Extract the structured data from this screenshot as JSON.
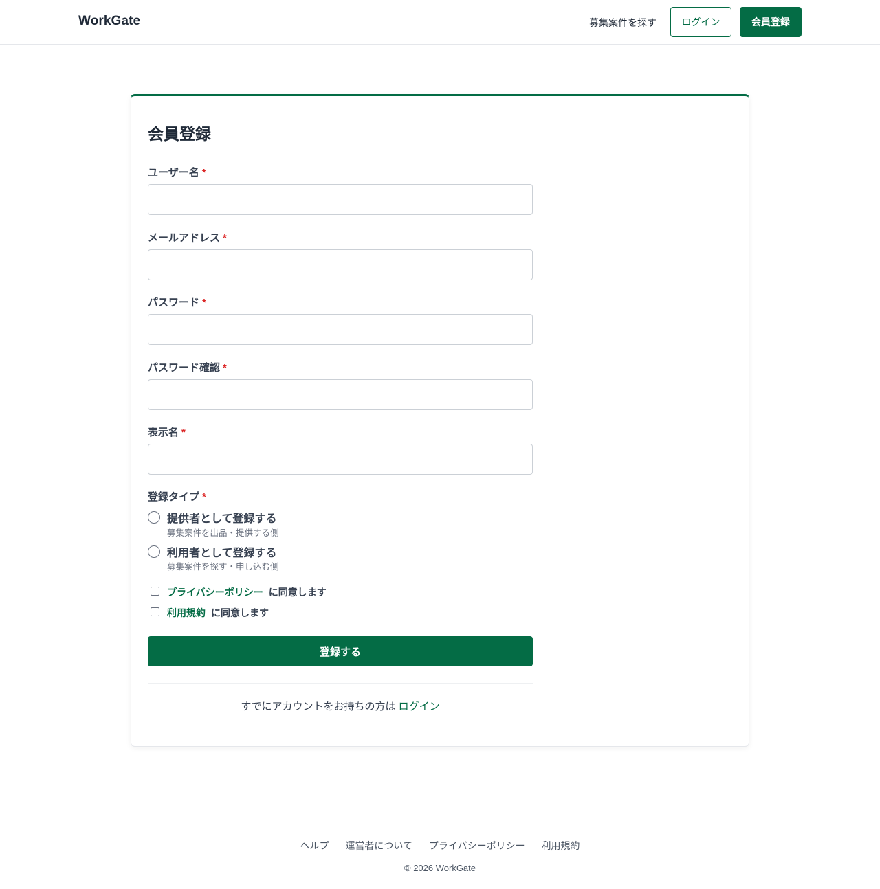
{
  "header": {
    "logo": "WorkGate",
    "nav_search": "募集案件を探す",
    "login_label": "ログイン",
    "register_label": "会員登録"
  },
  "form": {
    "title": "会員登録",
    "required_mark": "*",
    "fields": [
      {
        "label": "ユーザー名",
        "value": ""
      },
      {
        "label": "メールアドレス",
        "value": ""
      },
      {
        "label": "パスワード",
        "value": ""
      },
      {
        "label": "パスワード確認",
        "value": ""
      },
      {
        "label": "表示名",
        "value": ""
      }
    ],
    "type_label": "登録タイプ",
    "options": [
      {
        "title": "提供者として登録する",
        "desc": "募集案件を出品・提供する側",
        "selected": false
      },
      {
        "title": "利用者として登録する",
        "desc": "募集案件を探す・申し込む側",
        "selected": false
      }
    ],
    "agreements": [
      {
        "link": "プライバシーポリシー",
        "text": "に同意します",
        "checked": false
      },
      {
        "link": "利用規約",
        "text": "に同意します",
        "checked": false
      }
    ],
    "submit_label": "登録する",
    "have_account_text": "すでにアカウントをお持ちの方は",
    "login_link": "ログイン"
  },
  "footer": {
    "links": [
      "ヘルプ",
      "運営者について",
      "プライバシーポリシー",
      "利用規約"
    ],
    "copyright": "© 2026 WorkGate"
  },
  "colors": {
    "brand": "#046c45",
    "required": "#dc2626"
  }
}
